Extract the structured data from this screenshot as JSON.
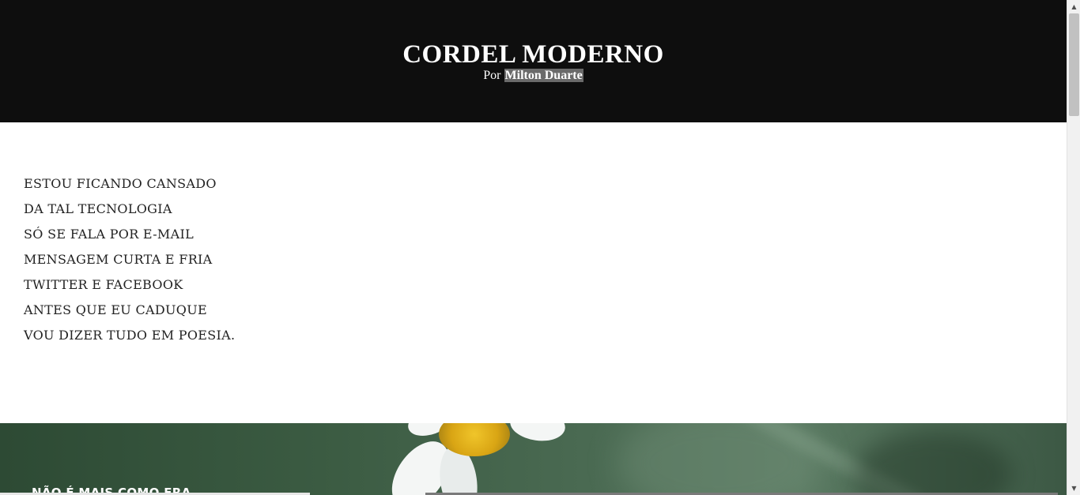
{
  "header": {
    "title": "CORDEL MODERNO",
    "byline_prefix": "Por",
    "author": "Milton Duarte"
  },
  "poem": {
    "lines": [
      "ESTOU FICANDO CANSADO",
      "DA TAL TECNOLOGIA",
      "SÓ SE FALA POR E-MAIL",
      "MENSAGEM CURTA E FRIA",
      "TWITTER E FACEBOOK",
      "ANTES QUE EU CADUQUE",
      "VOU DIZER TUDO EM POESIA."
    ]
  },
  "next_section": {
    "title": "NÃO É MAIS COMO ERA"
  },
  "scrollbar": {
    "up_arrow_icon": "chevron-up-icon",
    "down_arrow_icon": "chevron-down-icon",
    "up_glyph": "▲",
    "down_glyph": "▼"
  },
  "colors": {
    "header_bg": "#0e0e0e",
    "author_highlight": "#6a6a6a",
    "photo_green": "#3b5b42"
  }
}
